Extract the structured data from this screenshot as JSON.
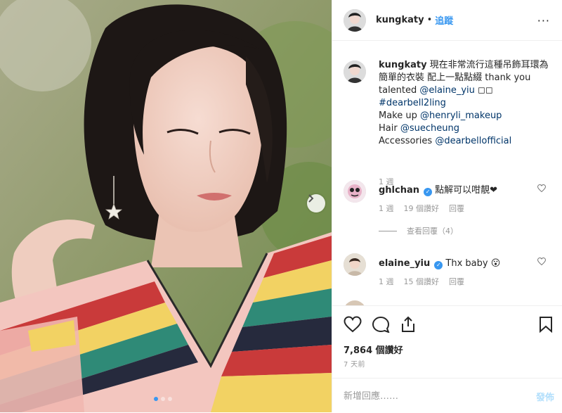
{
  "header": {
    "username": "kungkaty",
    "separator": "•",
    "follow_label": "追蹤",
    "more_label": "···"
  },
  "caption": {
    "username": "kungkaty",
    "text_1": "現在非常流行這種吊飾耳環為簡單的衣裝 配上一點點綴 thank you talented",
    "mention_1": "@elaine_yiu",
    "emoji": "◻◻",
    "hashtag": "#dearbell2ling",
    "makeup_label": "Make up",
    "mention_2": "@henryli_makeup",
    "hair_label": "Hair",
    "mention_3": "@suecheung",
    "accessories_label": "Accessories",
    "mention_4": "@dearbellofficial",
    "time": "1 週"
  },
  "comments": [
    {
      "username": "ghlchan",
      "verified": true,
      "text": "點解可以咁靚❤",
      "time": "1 週",
      "likes": "19 個讚好",
      "reply_label": "回覆",
      "view_replies": "查看回覆（4）"
    },
    {
      "username": "elaine_yiu",
      "verified": true,
      "text": "Thx baby 😮",
      "time": "1 週",
      "likes": "15 個讚好",
      "reply_label": "回覆"
    }
  ],
  "actions": {
    "likes": "7,864 個讚好",
    "age": "7 天前"
  },
  "add_comment": {
    "placeholder": "新增回應……",
    "post_label": "發佈"
  },
  "carousel": {
    "total": 3,
    "active_index": 0
  },
  "colors": {
    "accent": "#3897f0",
    "text": "#262626",
    "muted": "#999999",
    "post_disabled": "#b2dffc",
    "link": "#003569"
  },
  "icons": [
    "more-icon",
    "heart-icon",
    "comment-icon",
    "share-icon",
    "bookmark-icon",
    "chevron-right-icon",
    "verified-icon"
  ]
}
